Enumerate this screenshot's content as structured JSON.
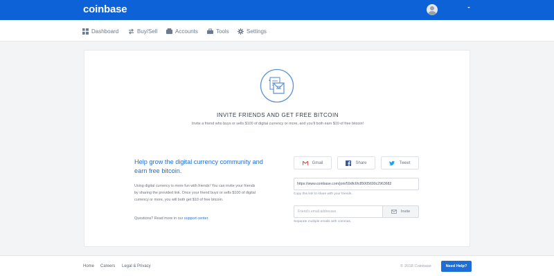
{
  "header": {
    "logo": "coinbase",
    "colors": {
      "brand": "#0c62d6",
      "accent": "#1f6ed6"
    }
  },
  "nav": {
    "items": [
      {
        "label": "Dashboard",
        "icon": "dashboard-icon"
      },
      {
        "label": "Buy/Sell",
        "icon": "swap-arrows-icon"
      },
      {
        "label": "Accounts",
        "icon": "bank-icon"
      },
      {
        "label": "Tools",
        "icon": "briefcase-icon"
      },
      {
        "label": "Settings",
        "icon": "gear-icon"
      }
    ]
  },
  "invite": {
    "title": "INVITE FRIENDS AND GET FREE BITCOIN",
    "subtitle": "Invite a friend who buys or sells $100 of digital currency or more, and you'll both earn $10 of free bitcoin!",
    "help_title": "Help grow the digital currency community and earn free bitcoin.",
    "help_body": "Using digital currency is more fun with friends! You can invite your friends by sharing the provided link. Once your friend buys or sells $100 of digital currency or more, you will both get $10 of free bitcoin.",
    "questions_prefix": "Questions? Read more in our",
    "support_link": "support center",
    "questions_suffix": ".",
    "share_buttons": [
      {
        "label": "Gmail",
        "icon": "gmail-icon"
      },
      {
        "label": "Share",
        "icon": "facebook-icon"
      },
      {
        "label": "Tweet",
        "icon": "twitter-icon"
      }
    ],
    "referral_link": "https://www.coinbase.com/join/59dfc6fc85005690c2963682",
    "referral_hint": "Copy this link to share with your friends.",
    "email_placeholder": "Friend's email addresses",
    "invite_label": "Invite",
    "email_hint": "Separate multiple emails with commas."
  },
  "footer": {
    "links": [
      "Home",
      "Careers",
      "Legal & Privacy"
    ],
    "copyright": "© 2018 Coinbase",
    "help_button": "Need Help?"
  }
}
